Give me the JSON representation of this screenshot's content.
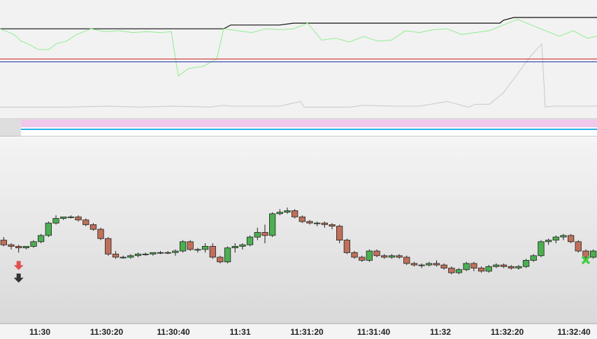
{
  "colors": {
    "indicator_bg": "#f2f2f2",
    "price_bg_top": "#f4f4f4",
    "price_bg_bottom": "#d9d9d9",
    "black_line": "#111111",
    "green_line": "#90ee90",
    "gray_line": "#c8c8c8",
    "red_level": "#cc2222",
    "blue_level": "#2233aa",
    "band_pink": "#f0c8ec",
    "band_blue": "#2ab0ec",
    "candle_up": "#4caf50",
    "candle_down": "#c0705a",
    "sell_arrow": "#e05050",
    "sell_arrow_dark": "#333333",
    "cross_marker": "#44cc44"
  },
  "chart_data": [
    {
      "type": "line",
      "panel": "indicator",
      "ylim": [
        0,
        100
      ],
      "series": [
        {
          "x": [
            0,
            40,
            80,
            120,
            160,
            200,
            240,
            280,
            320,
            330,
            400,
            420,
            500,
            600,
            700,
            715,
            720,
            735,
            854
          ],
          "values": [
            88,
            88,
            88,
            88,
            88,
            88,
            88,
            88,
            88,
            92,
            92,
            94,
            94,
            94,
            94,
            94,
            97,
            100,
            100
          ]
        },
        {
          "x": [
            0,
            20,
            30,
            40,
            55,
            70,
            80,
            95,
            110,
            130,
            150,
            170,
            190,
            210,
            230,
            245,
            255,
            270,
            290,
            310,
            320,
            340,
            360,
            380,
            400,
            420,
            440,
            460,
            480,
            500,
            520,
            540,
            560,
            580,
            600,
            620,
            640,
            660,
            680,
            700,
            720,
            740,
            760,
            780,
            800,
            820,
            840,
            854
          ],
          "values": [
            88,
            82,
            75,
            72,
            66,
            66,
            72,
            75,
            82,
            88,
            85,
            86,
            84,
            85,
            84,
            85,
            38,
            46,
            48,
            56,
            88,
            86,
            84,
            88,
            87,
            88,
            94,
            76,
            78,
            74,
            80,
            75,
            76,
            86,
            84,
            87,
            88,
            82,
            84,
            86,
            92,
            98,
            92,
            86,
            80,
            86,
            78,
            80
          ]
        },
        {
          "x": [
            0,
            100,
            150,
            200,
            250,
            300,
            320,
            330,
            400,
            430,
            435,
            500,
            520,
            560,
            600,
            640,
            670,
            680,
            700,
            720,
            740,
            760,
            775,
            780,
            790,
            854
          ],
          "values": [
            5,
            5,
            6,
            5,
            6,
            5,
            7,
            6,
            6,
            11,
            5,
            5,
            7,
            6,
            6,
            11,
            5,
            8,
            8,
            20,
            40,
            60,
            72,
            5,
            6,
            6
          ]
        }
      ],
      "levels": [
        {
          "value": 56
        },
        {
          "value": 53
        }
      ]
    },
    {
      "type": "candlestick",
      "panel": "price",
      "xlabel": "",
      "ylabel": "",
      "ylim": [
        0,
        100
      ],
      "tick_labels": [
        "11:30",
        "11:30:20",
        "11:30:40",
        "11:31",
        "11:31:20",
        "11:31:40",
        "11:32",
        "11:32:20",
        "11:32:40"
      ],
      "candles": [
        [
          52,
          54,
          48,
          49
        ],
        [
          49,
          50,
          46,
          48
        ],
        [
          48,
          49,
          44,
          47
        ],
        [
          47,
          48,
          46,
          48
        ],
        [
          48,
          52,
          47,
          51
        ],
        [
          51,
          56,
          50,
          55
        ],
        [
          55,
          64,
          54,
          63
        ],
        [
          63,
          68,
          62,
          66
        ],
        [
          66,
          67,
          65,
          67
        ],
        [
          67,
          68,
          66,
          67
        ],
        [
          67,
          68,
          64,
          65
        ],
        [
          65,
          66,
          61,
          62
        ],
        [
          62,
          63,
          58,
          59
        ],
        [
          59,
          60,
          52,
          53
        ],
        [
          53,
          54,
          42,
          43
        ],
        [
          43,
          45,
          40,
          41
        ],
        [
          41,
          42,
          40,
          41
        ],
        [
          41,
          43,
          40,
          42
        ],
        [
          42,
          44,
          41,
          43
        ],
        [
          43,
          44,
          42,
          43
        ],
        [
          43,
          44,
          42,
          44
        ],
        [
          44,
          45,
          43,
          44
        ],
        [
          44,
          45,
          43,
          44
        ],
        [
          44,
          46,
          42,
          45
        ],
        [
          45,
          52,
          44,
          51
        ],
        [
          51,
          52,
          45,
          46
        ],
        [
          46,
          47,
          44,
          46
        ],
        [
          46,
          50,
          44,
          48
        ],
        [
          48,
          50,
          40,
          41
        ],
        [
          41,
          42,
          37,
          38
        ],
        [
          38,
          48,
          37,
          47
        ],
        [
          47,
          50,
          44,
          48
        ],
        [
          48,
          50,
          46,
          49
        ],
        [
          49,
          55,
          48,
          54
        ],
        [
          54,
          60,
          52,
          57
        ],
        [
          57,
          62,
          50,
          55
        ],
        [
          55,
          70,
          54,
          69
        ],
        [
          69,
          72,
          68,
          70
        ],
        [
          70,
          73,
          69,
          71
        ],
        [
          71,
          72,
          66,
          67
        ],
        [
          67,
          68,
          63,
          64
        ],
        [
          64,
          65,
          62,
          63
        ],
        [
          63,
          64,
          61,
          63
        ],
        [
          63,
          64,
          60,
          62
        ],
        [
          62,
          63,
          59,
          61
        ],
        [
          61,
          62,
          50,
          52
        ],
        [
          52,
          53,
          43,
          44
        ],
        [
          44,
          45,
          40,
          41
        ],
        [
          41,
          42,
          38,
          39
        ],
        [
          39,
          46,
          38,
          45
        ],
        [
          45,
          46,
          41,
          42
        ],
        [
          42,
          43,
          40,
          41
        ],
        [
          41,
          43,
          40,
          42
        ],
        [
          42,
          43,
          40,
          41
        ],
        [
          41,
          42,
          36,
          37
        ],
        [
          37,
          38,
          35,
          36
        ],
        [
          36,
          37,
          34,
          36
        ],
        [
          36,
          38,
          35,
          37
        ],
        [
          37,
          39,
          35,
          36
        ],
        [
          36,
          37,
          33,
          34
        ],
        [
          34,
          35,
          30,
          31
        ],
        [
          31,
          34,
          30,
          33
        ],
        [
          33,
          38,
          32,
          37
        ],
        [
          37,
          38,
          32,
          34
        ],
        [
          34,
          35,
          31,
          32
        ],
        [
          32,
          36,
          31,
          35
        ],
        [
          35,
          37,
          34,
          36
        ],
        [
          36,
          37,
          34,
          35
        ],
        [
          35,
          36,
          33,
          34
        ],
        [
          34,
          36,
          33,
          35
        ],
        [
          35,
          40,
          34,
          39
        ],
        [
          39,
          43,
          38,
          42
        ],
        [
          42,
          52,
          41,
          51
        ],
        [
          51,
          53,
          49,
          52
        ],
        [
          52,
          55,
          50,
          54
        ],
        [
          54,
          56,
          52,
          55
        ],
        [
          55,
          56,
          50,
          51
        ],
        [
          51,
          52,
          44,
          45
        ],
        [
          45,
          46,
          40,
          41
        ],
        [
          41,
          46,
          40,
          45
        ]
      ],
      "markers": [
        {
          "kind": "sell-arrow",
          "index": 2
        },
        {
          "kind": "sell-arrow-dark",
          "index": 2
        },
        {
          "kind": "cross",
          "index": 78
        }
      ]
    }
  ]
}
